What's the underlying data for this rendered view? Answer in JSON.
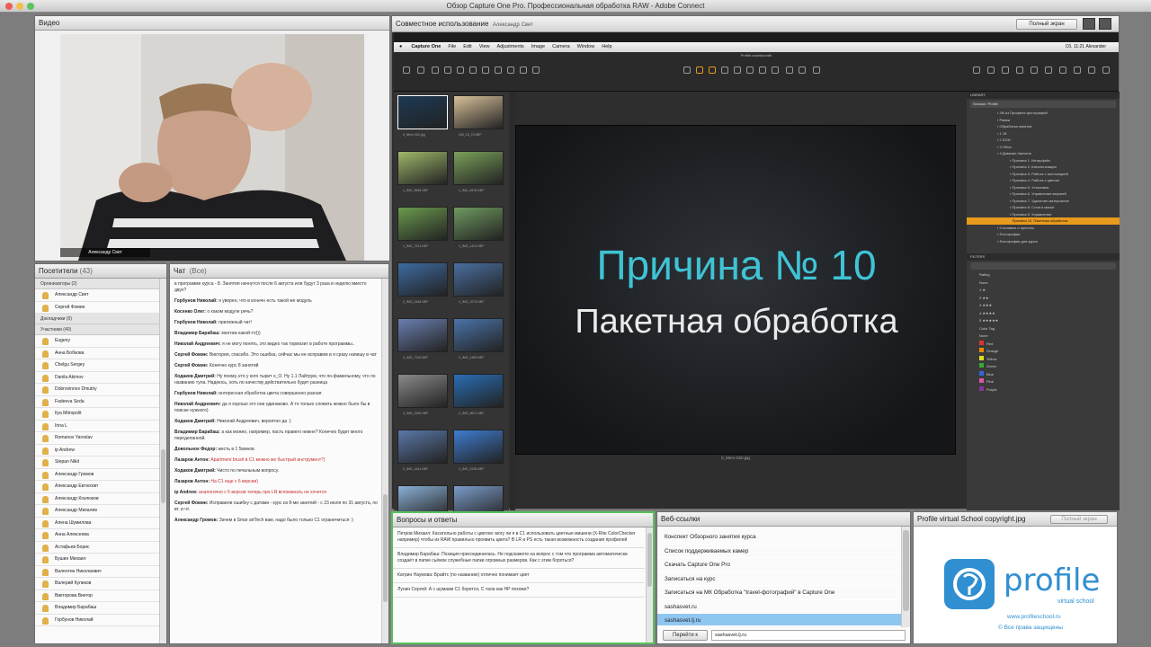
{
  "window_title": "Обзор Capture One Pro. Профессиональная обработка RAW - Adobe Connect",
  "video_pod": {
    "title": "Видео",
    "caption": "Александр Свет"
  },
  "attendees_pod": {
    "title": "Посетители",
    "count": "(43)",
    "groups": [
      {
        "label": "Организаторы (2)",
        "members": [
          "Александр Свет",
          "Сергей Фомин"
        ]
      },
      {
        "label": "Докладчики (0)",
        "members": []
      },
      {
        "label": "Участники (40)",
        "members": [
          "Eugeny",
          "Анна Бобкова",
          "Chelgu Sergey",
          "Danila Akimov",
          "Dobrovinnov Dmutriy",
          "Fadeeva Seda",
          "Ilya Mitropolit",
          "Irina L",
          "Romanov Yaroslav",
          "ip Andrew",
          "Stepan Nikit",
          "Александр Громов",
          "Александр Евтюховт",
          "Александр Козлюков",
          "Александр Михалев",
          "Алена Шумилова",
          "Анна Алексеева",
          "Астафьев Борис",
          "Бушин Михаил",
          "Валентин Николаевич",
          "Валерий Куликов",
          "Викторова Виктор",
          "Владимир Барабаш",
          "Горбунов Николай"
        ]
      }
    ]
  },
  "chat_pod": {
    "title": "Чат",
    "scope": "(Все)",
    "messages": [
      {
        "author": "",
        "text": "в программе курса - 8. Занятия начнутся после 6 августа или будут 3 раза в неделю вместо двух?",
        "red": false
      },
      {
        "author": "Горбунов Николай:",
        "text": "я уверен, что в конечн есть такой же модуль",
        "red": false
      },
      {
        "author": "Косенко Олег:",
        "text": "о каком модуле речь?",
        "red": false
      },
      {
        "author": "Горбунов Николай:",
        "text": "прилежный чат!",
        "red": false
      },
      {
        "author": "Владимир Барабаш:",
        "text": "монтаж какой-то)))",
        "red": false
      },
      {
        "author": "Николай Андреевич:",
        "text": "я не могу понять, это видео так тормозит в работе программы..",
        "red": false
      },
      {
        "author": "Сергей Фомин:",
        "text": "Виктория, спасибо. Это ошибка, сейчас мы ее исправим и я сразу напишу в чат",
        "red": false
      },
      {
        "author": "Сергей Фомин:",
        "text": "Конечно курс 8 занятий",
        "red": false
      },
      {
        "author": "Ходаков Дмитрий:",
        "text": "Ну поему, кто у кого тырит о_О. Ну 1.1 Лайтрум, что по-фамильному, что по названию тула. Надеюсь, хоть по качеству действительно будет разница",
        "red": false
      },
      {
        "author": "Горбунов Николай:",
        "text": "интересная обработка цвета совершенно разная",
        "red": false
      },
      {
        "author": "Николай Андреевич:",
        "text": "да я хорошо это они одинаково. А то только словить можно было бы в поиске нужного)",
        "red": false
      },
      {
        "author": "Ходаков Дмитрий:",
        "text": "Николай Андреевич, вероятно да :)",
        "red": false
      },
      {
        "author": "Владимир Барабаш:",
        "text": "а как можно, например, пасть правего нижне? Конечно будет много переделанной.",
        "red": false
      },
      {
        "author": "Довольное Федор:",
        "text": "жесть в 1 5минов",
        "red": false
      },
      {
        "author": "Лазаров Антон:",
        "text": "Apartment brush в C1 можно же быстрый инструмент?)",
        "red": true
      },
      {
        "author": "Ходаков Дмитрий:",
        "text": "Чисто по печальным вопросу.",
        "red": false
      },
      {
        "author": "Лазаров Антон:",
        "text": "На C1 еще с 6 версии)",
        "red": true
      },
      {
        "author": "ip Andrew:",
        "text": "аналогично с 5 версии теперь про LR вспоминать не хочется",
        "red": true
      },
      {
        "author": "Сергей Фомин:",
        "text": "Исправили ошибку с датами - курс из 8-ми занятий - с 23 июля по 31 августа, по вт. и чт.",
        "red": false
      },
      {
        "author": "Александр Громов:",
        "text": "Зачем в Smar artTech вам, надо было только C1 ограничиться :)",
        "red": false
      }
    ]
  },
  "screen_share": {
    "title": "Совместное использование",
    "presenter": "Александр Свет",
    "fullscreen_button": "Полный экран",
    "c1_menu": [
      "Capture One",
      "File",
      "Edit",
      "View",
      "Adjustments",
      "Image",
      "Camera",
      "Window",
      "Help"
    ],
    "c1_status": "Сб. 11:21   Alexander",
    "c1_doc": "Profile.cosessiondb",
    "viewer_filename": "0_Mem 01D.jpg",
    "slide_title": "Причина № 10",
    "slide_subtitle": "Пакетная обработка",
    "thumb_names": [
      "0_Mem 01D.jpg",
      "040_15_72.NEF",
      "1_IMG_9540.NEF",
      "1_IMG_8476.NEF",
      "1_IMG_7221.NEF",
      "1_IMG_1421.NEF",
      "2_IMG_0440.NEF",
      "2_IMG_1073.NEF",
      "2_IMG_7110.NEF",
      "2_IMG_1450.NEF",
      "2_IMG_3190.NEF",
      "2_IMG_9671.NEF",
      "2_IMG_1441.NEF",
      "2_IMG_3130.NEF",
      "3_IMG_7120.NEF",
      "3_IMG_3801.NEF"
    ],
    "library_items": [
      "JM из Профиля фотографий",
      "Рамки",
      "Обработка занятия",
      "1 18",
      "2 5100",
      "3 Обои",
      "4 Дивизия Занятия",
      "Причина 1. Интерфейс",
      "Причина 2. Каталогизация",
      "Причина 3. Работа с экспозицией",
      "Причина 4. Работа с цветом",
      "Причина 5. Установка",
      "Причина 6. Управление версией",
      "Причина 7. Удаление материалов",
      "Причина 8. Слои и маски",
      "Причина 9. Управление",
      "Причина 10. Пакетная обработка",
      "Стилевые и пресеты",
      "Фотографии",
      "Фотографии для курса"
    ],
    "filters": [
      "Rating",
      "None",
      "1 ★",
      "2 ★★",
      "3 ★★★",
      "4 ★★★★",
      "5 ★★★★★",
      "Color Tag",
      "None",
      "Red",
      "Orange",
      "Yellow",
      "Green",
      "Blue",
      "Pink",
      "Purple"
    ]
  },
  "qa_pod": {
    "title": "Вопросы и ответы",
    "items": [
      "Петров Михаил: Касательно работы с цветом: могу ли я в C1 использовать цветные мишени (X-Rite ColorChecker например) чтобы из RAW правильно проявить цвета? В LR и PS есть такая возможность создания профилей",
      "Владимир Барабаш: Позиция присоединилась. Не подскажете на вопрос с том что программа автоматически создаёт в папке сьёмок служебные папки огромных размеров. Как с этим бороться?",
      "Катрин Наумова: Брайтс (по названию) отлично понимает цвет",
      "Лунин Сергей: А с шумами C1 борется, С тала как НР похоже?"
    ]
  },
  "web_links_pod": {
    "title": "Веб-ссылки",
    "links": [
      "Конспект Обзорного занятия курса",
      "Список поддерживаемых камер",
      "Скачать Capture One Pro",
      "Записаться на курс",
      "Записаться на МК Обработка \"travel-фотографий\" в Capture One",
      "sashasvet.ru",
      "sashasvet.lj.ru"
    ],
    "selected_index": 6,
    "go_button": "Перейти к",
    "url_value": "sashasvet.lj.ru"
  },
  "logo_pod": {
    "title": "Profile virtual School copyright.jpg",
    "fullscreen_button": "Полный экран",
    "brand": "profile",
    "brand_sub": "virtual school",
    "site": "www.profileschool.ru",
    "rights": "© Все права защищены"
  },
  "colors": {
    "accent_cyan": "#3fc3d5",
    "qa_border": "#59c25a",
    "selection_blue": "#8fc6f0",
    "c1_orange": "#e89a1c",
    "logo_blue": "#2f8fd0"
  }
}
